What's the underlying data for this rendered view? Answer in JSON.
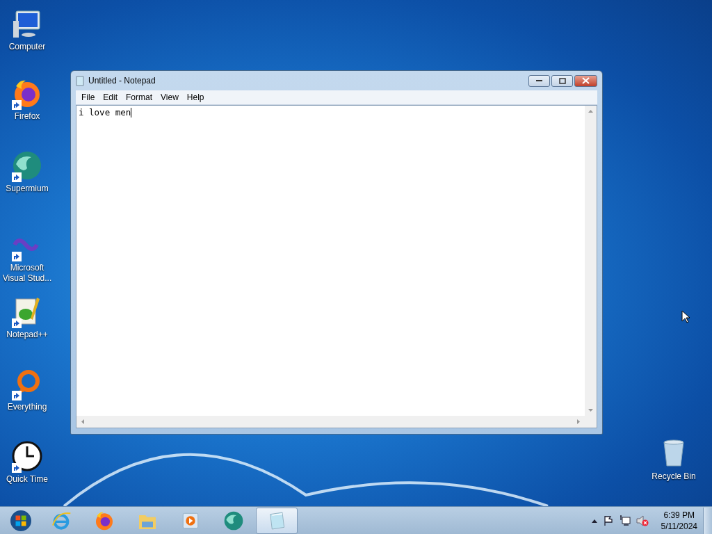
{
  "desktop_icons": [
    {
      "label": "Computer",
      "kind": "computer",
      "shortcut": false
    },
    {
      "label": "Firefox",
      "kind": "firefox",
      "shortcut": true
    },
    {
      "label": "Supermium",
      "kind": "supermium",
      "shortcut": true
    },
    {
      "label": "Microsoft Visual Stud...",
      "kind": "visualstudio",
      "shortcut": true
    },
    {
      "label": "Notepad++",
      "kind": "notepadpp",
      "shortcut": true
    },
    {
      "label": "Everything",
      "kind": "everything",
      "shortcut": true
    },
    {
      "label": "Quick Time",
      "kind": "clock",
      "shortcut": true
    },
    {
      "label": "Recycle Bin",
      "kind": "recycle",
      "shortcut": false
    }
  ],
  "window": {
    "title": "Untitled - Notepad",
    "menu": [
      "File",
      "Edit",
      "Format",
      "View",
      "Help"
    ],
    "text": "i love men"
  },
  "taskbar": {
    "items": [
      {
        "kind": "start",
        "selected": false
      },
      {
        "kind": "ie",
        "selected": false
      },
      {
        "kind": "firefox",
        "selected": false
      },
      {
        "kind": "explorer",
        "selected": false
      },
      {
        "kind": "media",
        "selected": false
      },
      {
        "kind": "supermium",
        "selected": false
      },
      {
        "kind": "notepad",
        "selected": true
      }
    ],
    "tray": {
      "time": "6:39 PM",
      "date": "5/11/2024"
    }
  }
}
